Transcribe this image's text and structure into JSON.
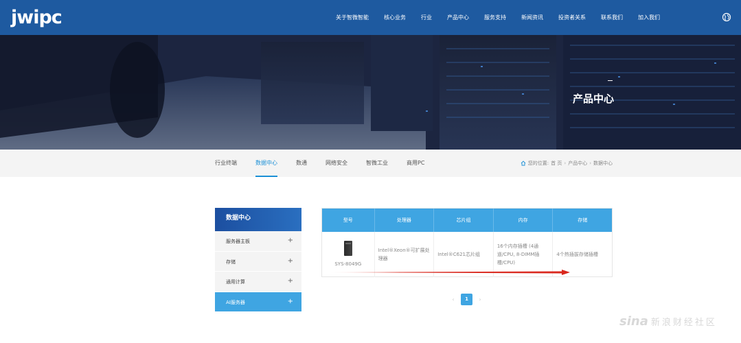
{
  "header": {
    "logo": "jwipc",
    "nav": [
      "关于智微智能",
      "核心业务",
      "行业",
      "产品中心",
      "服务支持",
      "新闻资讯",
      "投资者关系",
      "联系我们",
      "加入我们"
    ],
    "language_icon": "globe-icon"
  },
  "banner": {
    "title": "产品中心"
  },
  "tabs": {
    "items": [
      "行业终端",
      "数据中心",
      "数通",
      "网络安全",
      "智微工业",
      "商用PC"
    ],
    "active": "数据中心"
  },
  "breadcrumb": {
    "prefix": "您的位置:",
    "items": [
      "首 页",
      "产品中心",
      "数据中心"
    ]
  },
  "side_menu": {
    "title": "数据中心",
    "items": [
      {
        "label": "服务器主板",
        "active": false
      },
      {
        "label": "存储",
        "active": false
      },
      {
        "label": "通用计算",
        "active": false
      },
      {
        "label": "AI服务器",
        "active": true
      }
    ]
  },
  "table": {
    "headers": [
      "型号",
      "处理器",
      "芯片组",
      "内存",
      "存储"
    ],
    "rows": [
      {
        "model": "SYS-8049G",
        "processor": "Intel®Xeon®可扩展处理器",
        "chipset": "Intel®C621芯片组",
        "memory": "16个内存插槽 (4通道/CPU, 8-DIMM插槽/CPU)",
        "storage": "4个热插拔存储插槽"
      }
    ]
  },
  "pagination": {
    "current": "1",
    "prev": "‹",
    "next": "›"
  },
  "watermark": {
    "brand": "sina",
    "text": "新浪财经社区"
  },
  "colors": {
    "header_bg": "#1e5aa0",
    "accent": "#3fa5e2",
    "active_tab": "#1a8fd6",
    "arrow": "#d9261c"
  }
}
